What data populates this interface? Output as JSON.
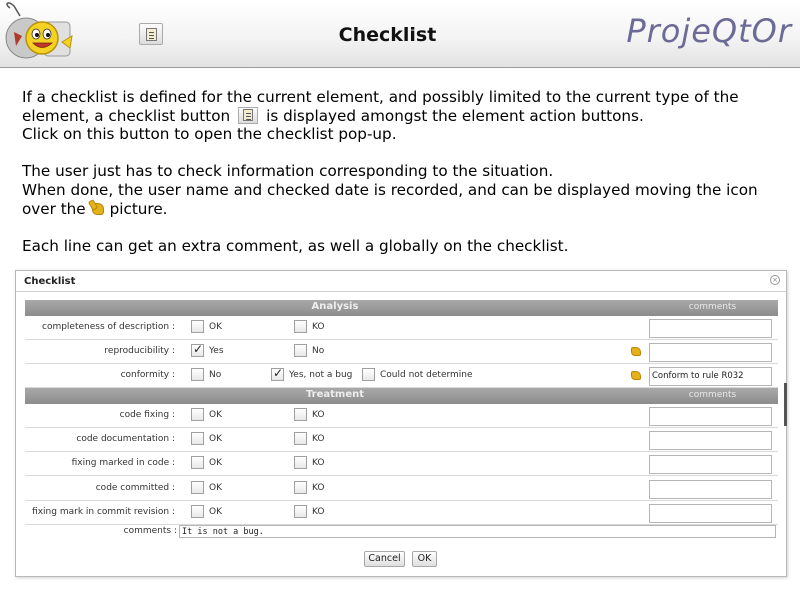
{
  "header": {
    "title": "Checklist",
    "brand": "ProjeQtOr",
    "checklist_button_icon": "checklist-icon"
  },
  "description": {
    "para1_a": "If a checklist is defined for the current element, and possibly limited to the current type of the element, a checklist button",
    "para1_b": "is displayed amongst the element action buttons.",
    "para1_c": "Click on this button to open the checklist pop-up.",
    "para2_a": "The user just has to check information corresponding to the situation.",
    "para2_b": "When done, the user name and checked date is recorded, and can be displayed moving the icon over the",
    "para2_c": "picture.",
    "para3": "Each line can get an extra comment, as well a globally on the checklist."
  },
  "dialog": {
    "title": "Checklist",
    "close_icon": "close-icon",
    "sections": [
      {
        "title": "Analysis",
        "comments_label": "comments",
        "rows": [
          {
            "label": "completeness of description :",
            "options": [
              {
                "text": "OK",
                "checked": false
              },
              {
                "text": "KO",
                "checked": false
              }
            ],
            "signed": false,
            "comment": ""
          },
          {
            "label": "reproducibility :",
            "options": [
              {
                "text": "Yes",
                "checked": true
              },
              {
                "text": "No",
                "checked": false
              }
            ],
            "signed": true,
            "comment": ""
          },
          {
            "label": "conformity :",
            "options": [
              {
                "text": "No",
                "checked": false
              },
              {
                "text": "Yes, not a bug",
                "checked": true
              },
              {
                "text": "Could not determine",
                "checked": false
              }
            ],
            "signed": true,
            "comment": "Conform to rule R032"
          }
        ]
      },
      {
        "title": "Treatment",
        "comments_label": "comments",
        "rows": [
          {
            "label": "code fixing :",
            "options": [
              {
                "text": "OK",
                "checked": false
              },
              {
                "text": "KO",
                "checked": false
              }
            ],
            "signed": false,
            "comment": ""
          },
          {
            "label": "code documentation :",
            "options": [
              {
                "text": "OK",
                "checked": false
              },
              {
                "text": "KO",
                "checked": false
              }
            ],
            "signed": false,
            "comment": ""
          },
          {
            "label": "fixing marked in code :",
            "options": [
              {
                "text": "OK",
                "checked": false
              },
              {
                "text": "KO",
                "checked": false
              }
            ],
            "signed": false,
            "comment": ""
          },
          {
            "label": "code committed :",
            "options": [
              {
                "text": "OK",
                "checked": false
              },
              {
                "text": "KO",
                "checked": false
              }
            ],
            "signed": false,
            "comment": ""
          },
          {
            "label": "fixing mark in commit revision :",
            "options": [
              {
                "text": "OK",
                "checked": false
              },
              {
                "text": "KO",
                "checked": false
              }
            ],
            "signed": false,
            "comment": ""
          }
        ]
      }
    ],
    "global_comment_label": "comments :",
    "global_comment": "It is not a bug.",
    "cancel_label": "Cancel",
    "ok_label": "OK"
  }
}
